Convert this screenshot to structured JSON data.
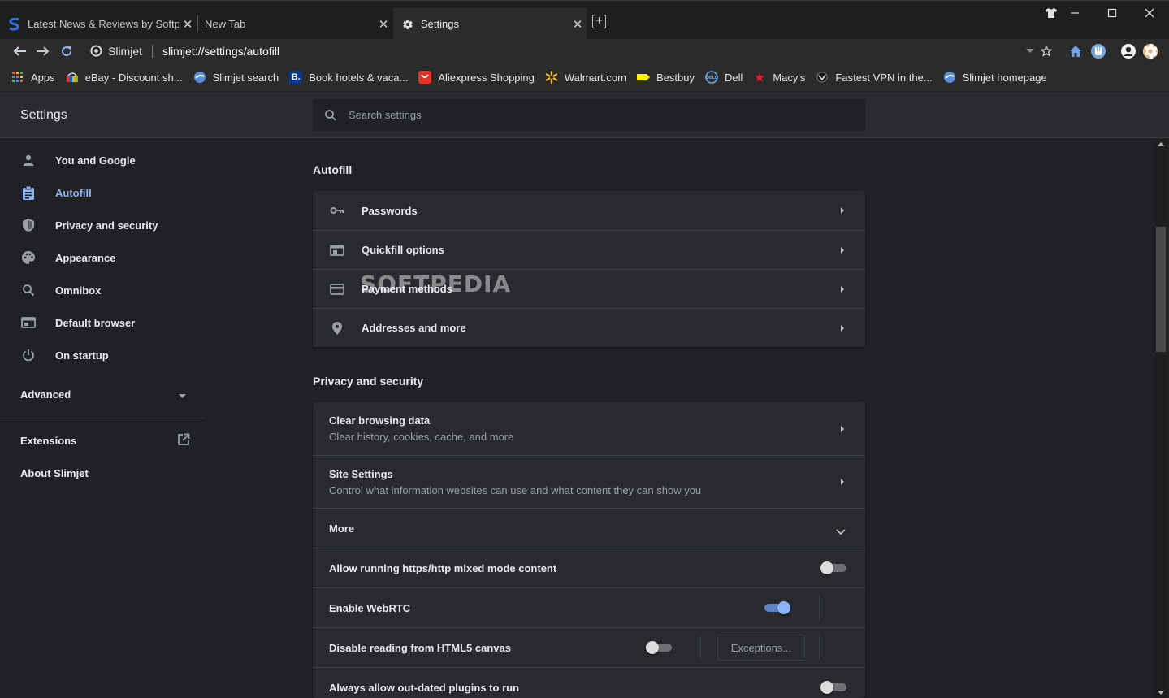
{
  "tabs": [
    {
      "title": "Latest News & Reviews by Softpedia",
      "favicon": "softpedia-s-icon",
      "active": false
    },
    {
      "title": "New Tab",
      "favicon": "",
      "active": false
    },
    {
      "title": "Settings",
      "favicon": "gear-icon",
      "active": true
    }
  ],
  "newtab_label": "+",
  "toolbar": {
    "site_name": "Slimjet",
    "url": "slimjet://settings/autofill"
  },
  "bookmarks": [
    {
      "label": "Apps",
      "icon": "apps-grid-icon"
    },
    {
      "label": "eBay - Discount sh...",
      "icon": "ebay-icon"
    },
    {
      "label": "Slimjet search",
      "icon": "slimjet-icon"
    },
    {
      "label": "Book hotels & vaca...",
      "icon": "booking-icon"
    },
    {
      "label": "Aliexpress Shopping",
      "icon": "aliexpress-icon"
    },
    {
      "label": "Walmart.com",
      "icon": "walmart-icon"
    },
    {
      "label": "Bestbuy",
      "icon": "bestbuy-icon"
    },
    {
      "label": "Dell",
      "icon": "dell-icon"
    },
    {
      "label": "Macy's",
      "icon": "macys-star-icon"
    },
    {
      "label": "Fastest VPN in the...",
      "icon": "vpn-icon"
    },
    {
      "label": "Slimjet homepage",
      "icon": "slimjet-icon"
    }
  ],
  "settings": {
    "title": "Settings",
    "search_placeholder": "Search settings"
  },
  "sidebar": {
    "items": [
      {
        "label": "You and Google",
        "icon": "person-icon"
      },
      {
        "label": "Autofill",
        "icon": "clipboard-icon",
        "active": true
      },
      {
        "label": "Privacy and security",
        "icon": "shield-icon"
      },
      {
        "label": "Appearance",
        "icon": "palette-icon"
      },
      {
        "label": "Omnibox",
        "icon": "search-icon"
      },
      {
        "label": "Default browser",
        "icon": "browser-icon"
      },
      {
        "label": "On startup",
        "icon": "power-icon"
      }
    ],
    "advanced": "Advanced",
    "extensions": "Extensions",
    "about": "About Slimjet"
  },
  "autofill": {
    "title": "Autofill",
    "rows": [
      {
        "label": "Passwords",
        "icon": "key-icon"
      },
      {
        "label": "Quickfill options",
        "icon": "form-icon"
      },
      {
        "label": "Payment methods",
        "icon": "credit-card-icon"
      },
      {
        "label": "Addresses and more",
        "icon": "location-pin-icon"
      }
    ]
  },
  "privacy": {
    "title": "Privacy and security",
    "clear_label": "Clear browsing data",
    "clear_sub": "Clear history, cookies, cache, and more",
    "site_label": "Site Settings",
    "site_sub": "Control what information websites can use and what content they can show you",
    "more_label": "More",
    "mixed_label": "Allow running https/http mixed mode content",
    "mixed_on": false,
    "webrtc_label": "Enable WebRTC",
    "webrtc_on": true,
    "canvas_label": "Disable reading from HTML5 canvas",
    "canvas_on": false,
    "exceptions_label": "Exceptions...",
    "plugins_label": "Always allow out-dated plugins to run",
    "plugins_on": false
  },
  "watermark": "SOFTPEDIA",
  "colors": {
    "accent": "#8ab4f8",
    "background": "#202124",
    "card": "#292a2d"
  }
}
